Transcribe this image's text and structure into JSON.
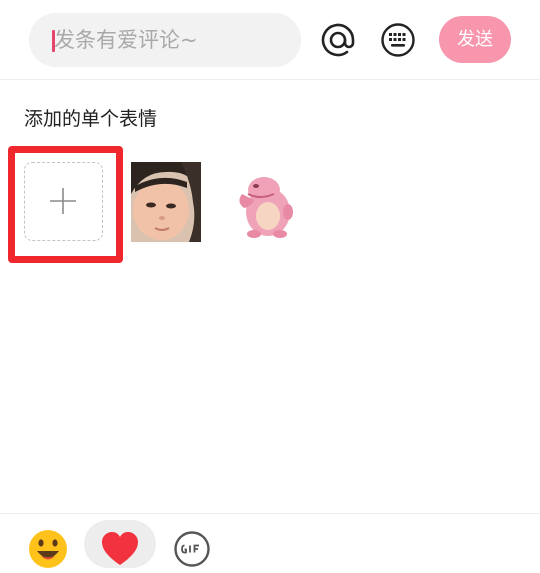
{
  "comment_bar": {
    "placeholder": "发条有爱评论~",
    "send_label": "发送",
    "icons": [
      "at-icon",
      "keyboard-icon"
    ],
    "send_color": "#f896ae",
    "caret_color": "#e8456d"
  },
  "sticker_panel": {
    "section_title": "添加的单个表情",
    "add_button_icon": "plus-icon",
    "highlight_color": "#f0272d",
    "stickers": [
      {
        "icon": "baby-face-sticker"
      },
      {
        "icon": "pink-creature-sticker"
      }
    ]
  },
  "bottom_tabs": {
    "items": [
      {
        "icon": "emoji-icon",
        "selected": false
      },
      {
        "icon": "heart-icon",
        "selected": true
      },
      {
        "icon": "gif-icon",
        "selected": false
      }
    ],
    "heart_color": "#f2333f"
  }
}
